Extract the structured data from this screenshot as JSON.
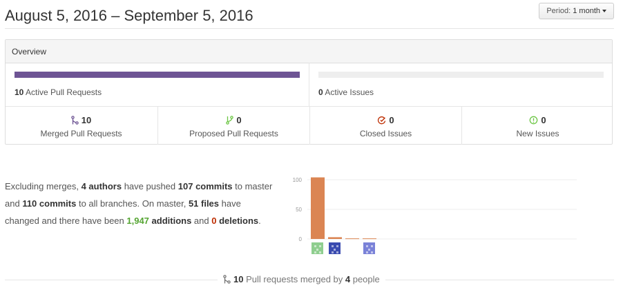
{
  "header": {
    "date_range": "August 5, 2016 – September 5, 2016",
    "period_label": "Period:",
    "period_value": "1 month"
  },
  "overview": {
    "title": "Overview",
    "pull_requests_active_count": "10",
    "pull_requests_active_label": "Active Pull Requests",
    "pull_requests_bar_fraction": 1.0,
    "issues_active_count": "0",
    "issues_active_label": "Active Issues",
    "issues_bar_fraction": 0.0,
    "stats": [
      {
        "icon": "merged-pr-icon",
        "count": "10",
        "label": "Merged Pull Requests",
        "color": "#6e5494"
      },
      {
        "icon": "proposed-pr-icon",
        "count": "0",
        "label": "Proposed Pull Requests",
        "color": "#6cc644"
      },
      {
        "icon": "closed-issue-icon",
        "count": "0",
        "label": "Closed Issues",
        "color": "#bd2c00"
      },
      {
        "icon": "new-issue-icon",
        "count": "0",
        "label": "New Issues",
        "color": "#6cc644"
      }
    ]
  },
  "summary": {
    "t1": "Excluding merges, ",
    "authors": "4 authors",
    "t2": " have pushed ",
    "commits_master": "107 commits",
    "t3": " to master and ",
    "commits_all": "110 commits",
    "t4": " to all branches. On master, ",
    "files": "51 files",
    "t5": " have changed and there have been ",
    "additions_num": "1,947",
    "additions_word": " additions",
    "t6": " and ",
    "deletions_num": "0",
    "deletions_word": "deletions",
    "t7": "."
  },
  "chart_data": {
    "type": "bar",
    "categories": [
      "author 1",
      "author 2",
      "author 3",
      "author 4"
    ],
    "values": [
      104,
      3,
      1,
      1
    ],
    "ylim": [
      0,
      100
    ],
    "yticks": [
      0,
      50,
      100
    ],
    "grid": true,
    "bar_color": "#db8553",
    "avatar_colors": [
      "#8fce8f",
      "#3a4bb0",
      "#ffffff",
      "#7a82d8"
    ]
  },
  "footer": {
    "count": "10",
    "t1": " Pull requests merged by ",
    "people_count": "4",
    "t2": " people"
  },
  "colors": {
    "accent_purple": "#6e5494",
    "green": "#55a532",
    "red": "#bd2c00"
  }
}
